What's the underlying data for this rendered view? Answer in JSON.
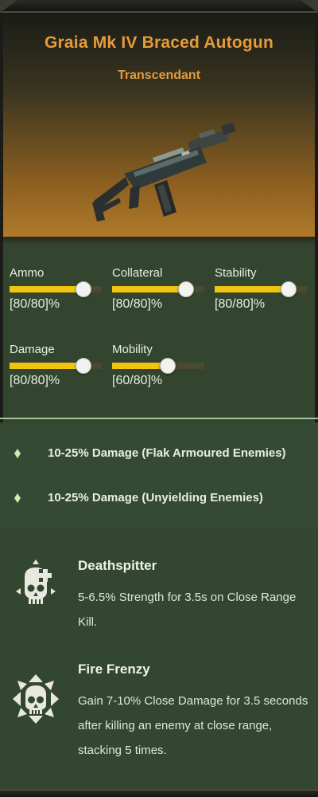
{
  "weapon": {
    "name": "Graia Mk IV Braced Autogun",
    "rarity": "Transcendant",
    "image_icon": "autogun-weapon-icon"
  },
  "stats": [
    {
      "label": "Ammo",
      "value": "[80/80]%",
      "level": 0.8
    },
    {
      "label": "Collateral",
      "value": "[80/80]%",
      "level": 0.8
    },
    {
      "label": "Stability",
      "value": "[80/80]%",
      "level": 0.8
    },
    {
      "label": "Damage",
      "value": "[80/80]%",
      "level": 0.8
    },
    {
      "label": "Mobility",
      "value": "[60/80]%",
      "level": 0.6
    }
  ],
  "modifiers": [
    {
      "text": "10-25% Damage (Flak Armoured Enemies)"
    },
    {
      "text": "10-25% Damage (Unyielding Enemies)"
    }
  ],
  "blessings": [
    {
      "title": "Deathspitter",
      "icon": "skull-plus-icon",
      "desc_lines": [
        "5-6.5% Strength for 3.5s on Close Range",
        "Kill."
      ]
    },
    {
      "title": "Fire Frenzy",
      "icon": "skull-burst-icon",
      "desc_lines": [
        "Gain 7-10% Close Damage for 3.5 seconds",
        "after killing an enemy at close range,",
        "stacking 5 times."
      ]
    }
  ],
  "colors": {
    "title": "#e59b3c",
    "bar_fill": "#f1c40f",
    "panel": "#33452f",
    "bullet": "#c9f0b0"
  }
}
